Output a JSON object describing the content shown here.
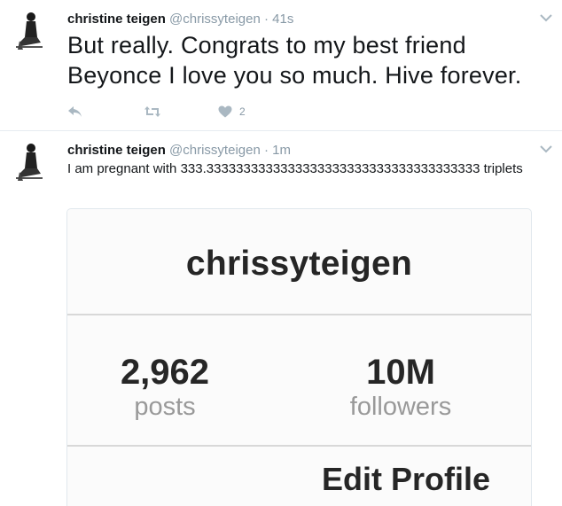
{
  "tweets": [
    {
      "author_name": "christine teigen",
      "author_handle": "@chrissyteigen",
      "separator": "·",
      "time": "41s",
      "text": "But really. Congrats to my best friend Beyonce I love you so much. Hive forever.",
      "like_count": "2"
    },
    {
      "author_name": "christine teigen",
      "author_handle": "@chrissyteigen",
      "separator": "·",
      "time": "1m",
      "text": "I am pregnant with 333.3333333333333333333333333333333333333 triplets",
      "media": {
        "username": "chrissyteigen",
        "posts_value": "2,962",
        "posts_label": "posts",
        "followers_value": "10M",
        "followers_label": "followers",
        "edit_profile_label": "Edit Profile"
      }
    }
  ],
  "icons": {
    "reply": "reply-icon",
    "retweet": "retweet-icon",
    "like": "heart-icon",
    "caret": "chevron-down-icon"
  },
  "colors": {
    "muted": "#8899a6",
    "action": "#aab8c2",
    "text": "#14171a"
  }
}
